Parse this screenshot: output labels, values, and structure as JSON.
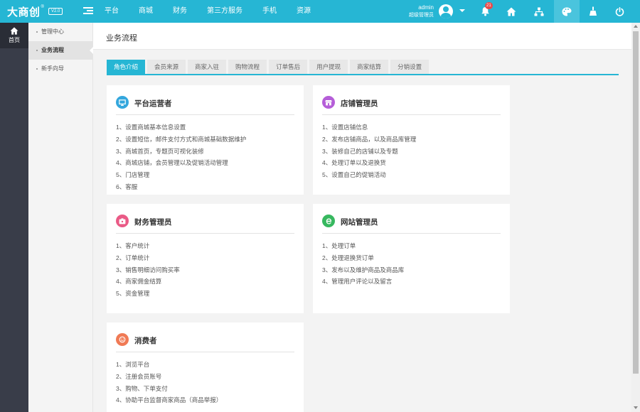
{
  "brand": {
    "name": "大商创",
    "reg": "®",
    "version": "V2.0"
  },
  "colors": {
    "topbar": "#26b6d4",
    "rail": "#393d49",
    "accent": "#26b6d4"
  },
  "topnav": [
    "平台",
    "商城",
    "财务",
    "第三方服务",
    "手机",
    "资源"
  ],
  "user": {
    "name": "admin",
    "role": "超级管理员"
  },
  "notifications": {
    "count": "21"
  },
  "top_icons": [
    "bell-icon",
    "home-icon",
    "sitemap-icon",
    "palette-icon",
    "broom-icon",
    "power-icon"
  ],
  "rail": {
    "home_label": "首页"
  },
  "submenu": [
    "管理中心",
    "业务流程",
    "新手向导"
  ],
  "page": {
    "title": "业务流程"
  },
  "tabs": [
    "角色介绍",
    "会员来源",
    "商家入驻",
    "购物流程",
    "订单售后",
    "用户提现",
    "商家结算",
    "分销设置"
  ],
  "cards": [
    {
      "title": "平台运营者",
      "icon": "monitor-icon",
      "icon_color": "#34a7dd",
      "items": [
        "1、设置商城基本信息设置",
        "2、设置短信，邮件支付方式和商城基础数据维护",
        "3、商城首页，专题页可视化装修",
        "4、商城店铺，会员管理以及促销活动管理",
        "5、门店管理",
        "6、客服"
      ]
    },
    {
      "title": "店铺管理员",
      "icon": "store-icon",
      "icon_color": "#b55ed8",
      "items": [
        "1、设置店铺信息",
        "2、发布店铺商品，以及商品库管理",
        "3、装修自己的店铺以及专题",
        "4、处理订单以及退换货",
        "5、设置自己的促销活动"
      ]
    },
    {
      "title": "财务管理员",
      "icon": "wallet-icon",
      "icon_color": "#ea5a86",
      "items": [
        "1、客户统计",
        "2、订单统计",
        "3、销售明细访问购买率",
        "4、商家佣金结算",
        "5、资金管理"
      ]
    },
    {
      "title": "网站管理员",
      "icon": "ie-icon",
      "icon_color": "#37b85f",
      "items": [
        "1、处理订单",
        "2、处理退换货订单",
        "3、发布以及维护商品及商品库",
        "4、管理用户评论以及留言"
      ]
    },
    {
      "title": "消费者",
      "icon": "user-icon",
      "icon_color": "#f07a55",
      "items": [
        "1、浏览平台",
        "2、注册会员账号",
        "3、购物、下单支付",
        "4、协助平台监督商家商品（商品举报）"
      ]
    }
  ]
}
